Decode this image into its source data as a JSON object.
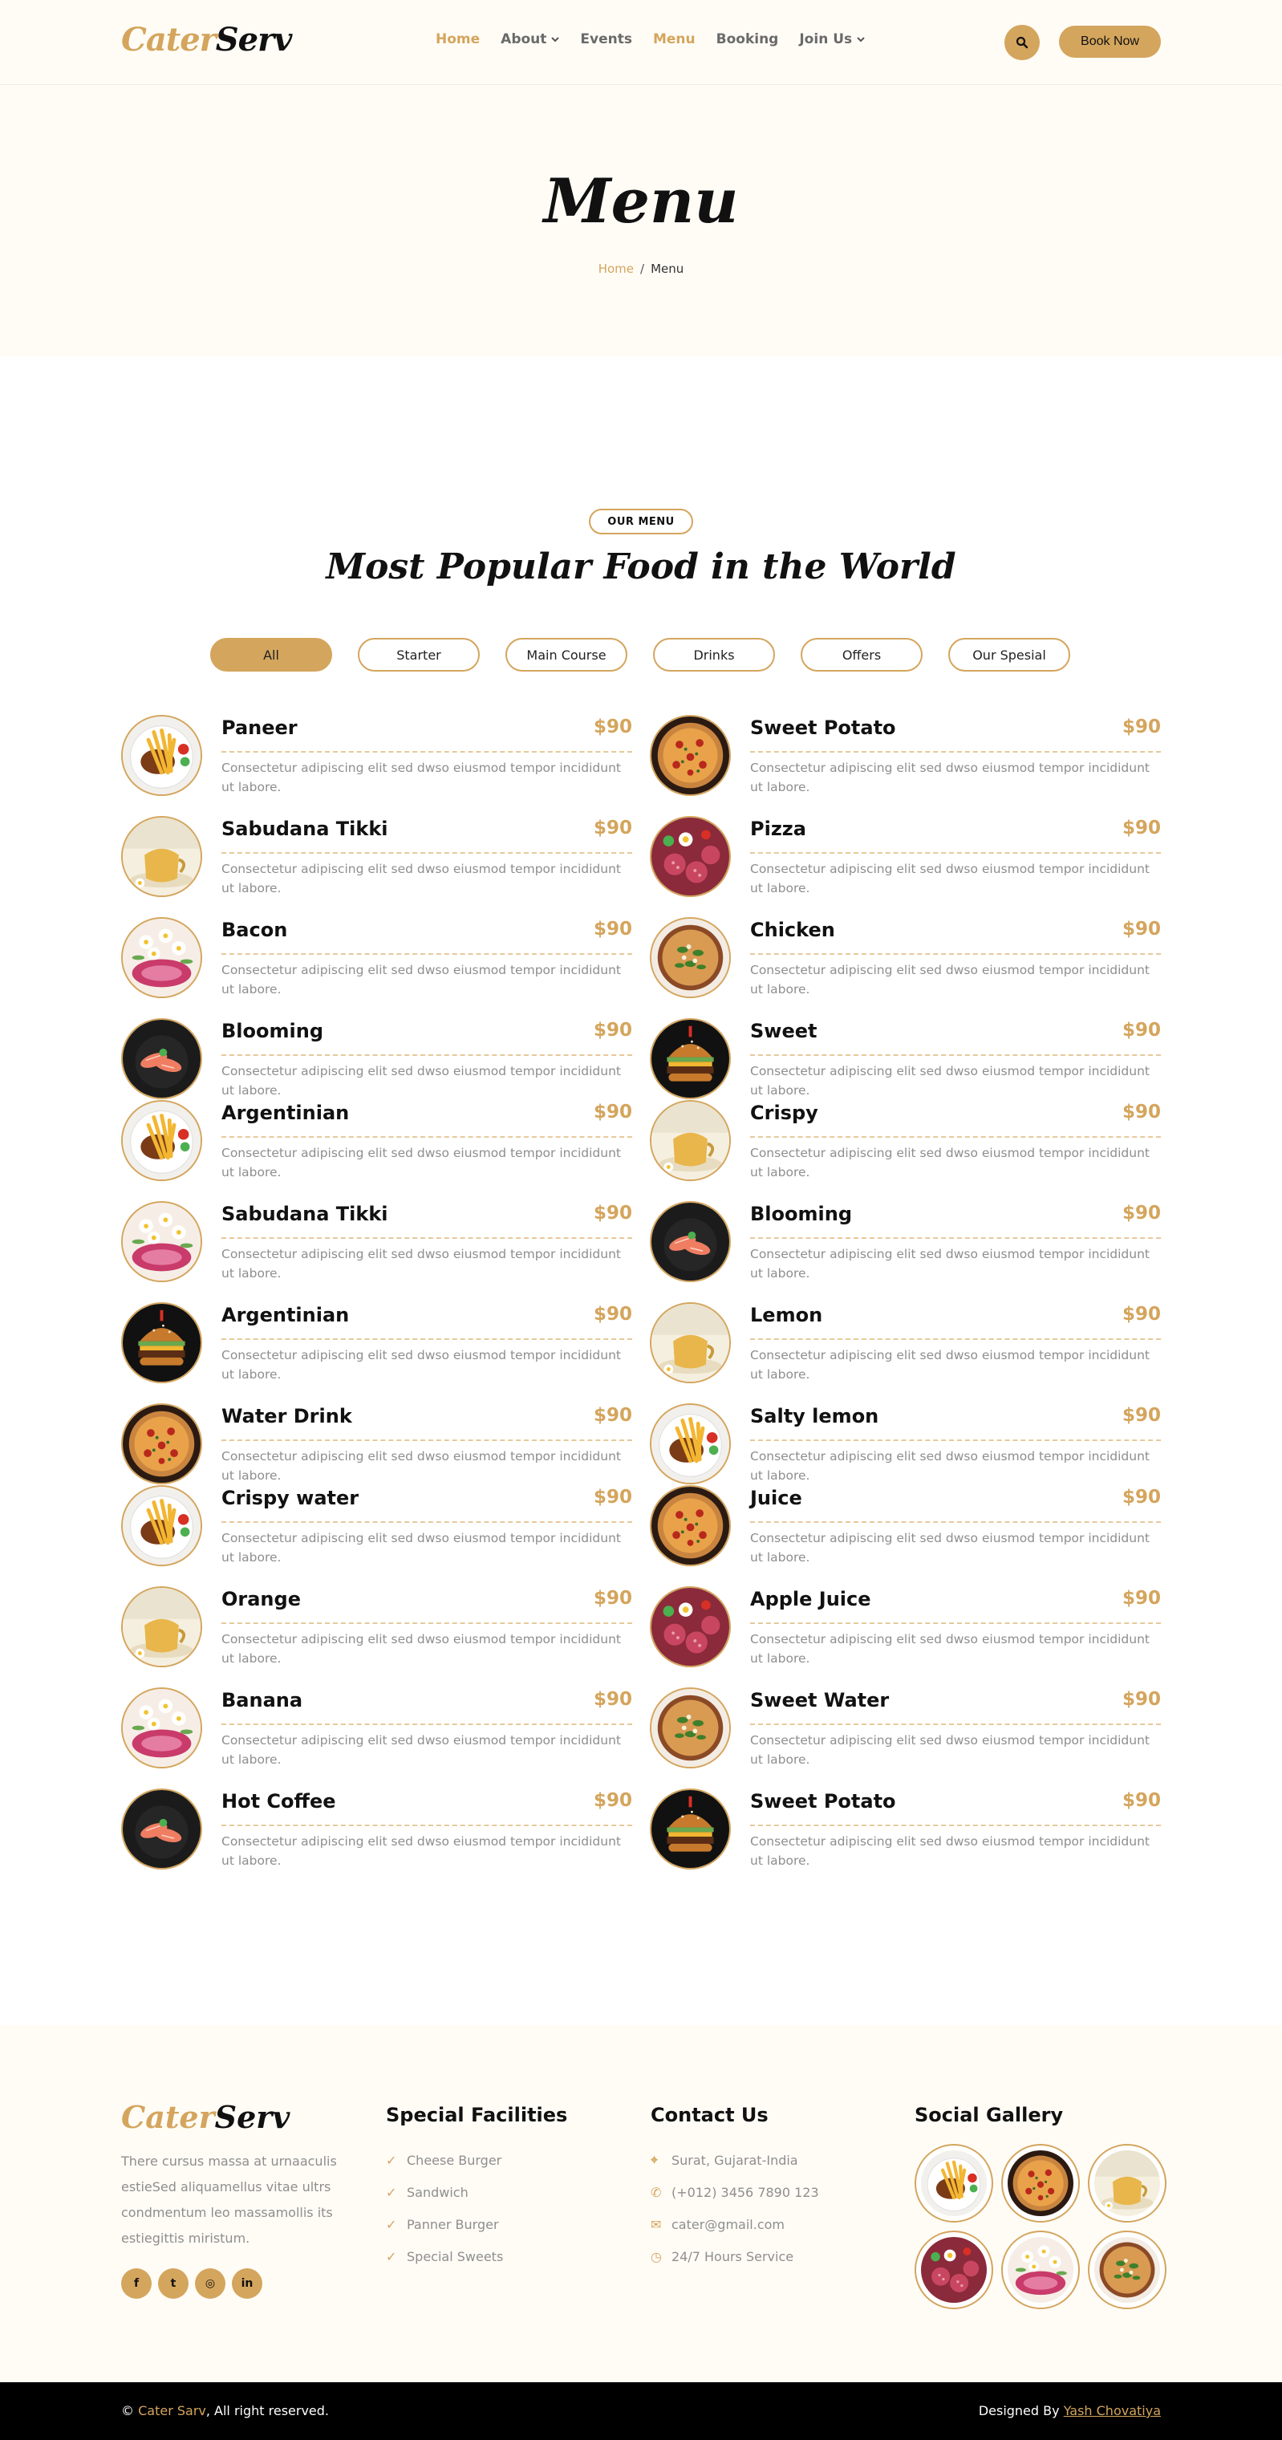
{
  "brand": {
    "part1": "Cater",
    "part2": "Serv"
  },
  "nav": {
    "items": [
      {
        "label": "Home",
        "active": true,
        "dropdown": false
      },
      {
        "label": "About",
        "active": false,
        "dropdown": true
      },
      {
        "label": "Events",
        "active": false,
        "dropdown": false
      },
      {
        "label": "Menu",
        "active": true,
        "dropdown": false
      },
      {
        "label": "Booking",
        "active": false,
        "dropdown": false
      },
      {
        "label": "Join Us",
        "active": false,
        "dropdown": true
      }
    ],
    "search_icon": "search-icon",
    "book_label": "Book Now"
  },
  "header": {
    "title": "Menu",
    "breadcrumb": {
      "home": "Home",
      "separator": "/",
      "current": "Menu"
    }
  },
  "menu": {
    "badge": "OUR MENU",
    "title": "Most Popular Food in the World",
    "filters": [
      "All",
      "Starter",
      "Main Course",
      "Drinks",
      "Offers",
      "Our Spesial"
    ],
    "active_filter": "All",
    "description": "Consectetur adipiscing elit sed dwso eiusmod tempor incididunt ut labore.",
    "left": [
      {
        "name": "Paneer",
        "price": "$90",
        "img": "fries"
      },
      {
        "name": "Sabudana Tikki",
        "price": "$90",
        "img": "tea"
      },
      {
        "name": "Bacon",
        "price": "$90",
        "img": "flower"
      },
      {
        "name": "Blooming",
        "price": "$90",
        "img": "salmon"
      },
      {
        "name": "Argentinian",
        "price": "$90",
        "img": "fries"
      },
      {
        "name": "Sabudana Tikki",
        "price": "$90",
        "img": "flower"
      },
      {
        "name": "Argentinian",
        "price": "$90",
        "img": "burger"
      },
      {
        "name": "Water Drink",
        "price": "$90",
        "img": "pizza"
      },
      {
        "name": "Crispy water",
        "price": "$90",
        "img": "fries"
      },
      {
        "name": "Orange",
        "price": "$90",
        "img": "tea"
      },
      {
        "name": "Banana",
        "price": "$90",
        "img": "flower"
      },
      {
        "name": "Hot Coffee",
        "price": "$90",
        "img": "salmon"
      }
    ],
    "right": [
      {
        "name": "Sweet Potato",
        "price": "$90",
        "img": "pizza"
      },
      {
        "name": "Pizza",
        "price": "$90",
        "img": "salami"
      },
      {
        "name": "Chicken",
        "price": "$90",
        "img": "veg-pizza"
      },
      {
        "name": "Sweet",
        "price": "$90",
        "img": "burger"
      },
      {
        "name": "Crispy",
        "price": "$90",
        "img": "tea"
      },
      {
        "name": "Blooming",
        "price": "$90",
        "img": "salmon"
      },
      {
        "name": "Lemon",
        "price": "$90",
        "img": "tea"
      },
      {
        "name": "Salty lemon",
        "price": "$90",
        "img": "fries"
      },
      {
        "name": "Juice",
        "price": "$90",
        "img": "pizza"
      },
      {
        "name": "Apple Juice",
        "price": "$90",
        "img": "salami"
      },
      {
        "name": "Sweet Water",
        "price": "$90",
        "img": "veg-pizza"
      },
      {
        "name": "Sweet Potato",
        "price": "$90",
        "img": "burger"
      }
    ]
  },
  "footer": {
    "about": "There cursus massa at urnaaculis estieSed aliquamellus vitae ultrs condmentum leo massamollis its estiegittis miristum.",
    "social": [
      {
        "icon": "facebook-icon",
        "glyph": "f"
      },
      {
        "icon": "twitter-icon",
        "glyph": "t"
      },
      {
        "icon": "instagram-icon",
        "glyph": "◎"
      },
      {
        "icon": "linkedin-icon",
        "glyph": "in"
      }
    ],
    "facilities": {
      "title": "Special Facilities",
      "items": [
        "Cheese Burger",
        "Sandwich",
        "Panner Burger",
        "Special Sweets"
      ]
    },
    "contact": {
      "title": "Contact Us",
      "items": [
        {
          "icon": "map-pin-icon",
          "glyph": "⌖",
          "text": "Surat, Gujarat-India"
        },
        {
          "icon": "phone-icon",
          "glyph": "✆",
          "text": "(+012) 3456 7890 123"
        },
        {
          "icon": "envelope-icon",
          "glyph": "✉",
          "text": "cater@gmail.com"
        },
        {
          "icon": "clock-icon",
          "glyph": "◷",
          "text": "24/7 Hours Service"
        }
      ]
    },
    "gallery": {
      "title": "Social Gallery",
      "images": [
        "fries",
        "pizza",
        "tea",
        "salami",
        "flower",
        "veg-pizza"
      ]
    }
  },
  "copyright": {
    "symbol": "©",
    "brand": "Cater Sarv",
    "rest": ", All right reserved.",
    "designed_by": "Designed By",
    "author": "Yash Chovatiya"
  },
  "colors": {
    "accent": "#d4a55d",
    "cream": "#fffcf6",
    "dark": "#000000"
  }
}
